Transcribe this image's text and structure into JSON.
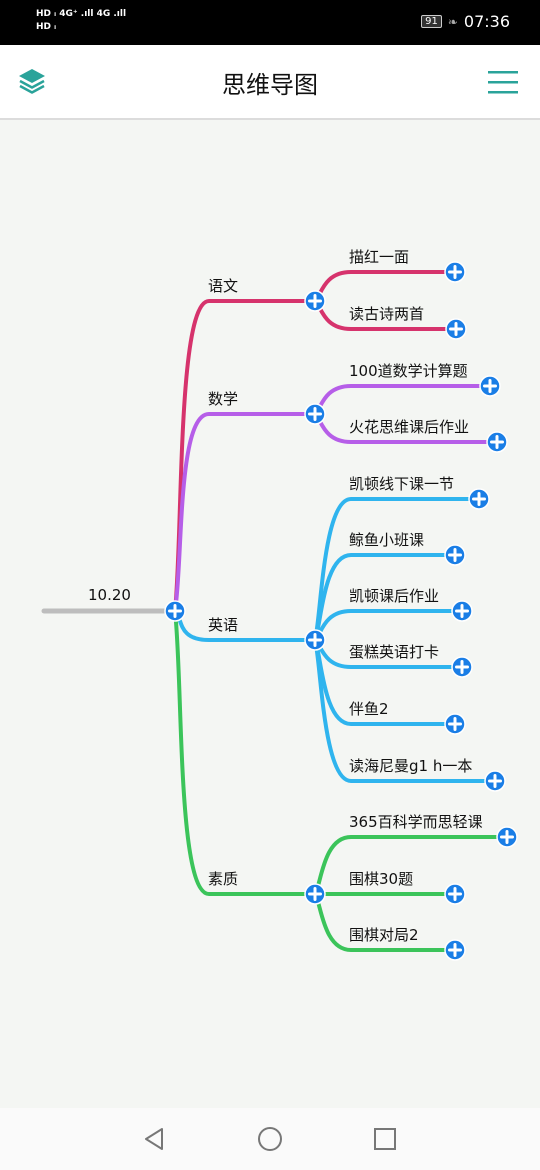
{
  "status_bar": {
    "left_top": "HD ᵢ 4G⁺ .ıll 4G .ıll",
    "left_bottom": "HD ᵢ",
    "battery": "91",
    "time": "07:36"
  },
  "header": {
    "title": "思维导图",
    "icons": {
      "left": "layers-icon",
      "right": "menu-icon"
    }
  },
  "mindmap": {
    "root": {
      "label": "10.20"
    },
    "branches": [
      {
        "label": "语文",
        "color": "#d6336c",
        "children": [
          "描红一面",
          "读古诗两首"
        ]
      },
      {
        "label": "数学",
        "color": "#b65ee8",
        "children": [
          "100道数学计算题",
          "火花思维课后作业"
        ]
      },
      {
        "label": "英语",
        "color": "#2fb4ee",
        "children": [
          "凯顿线下课一节",
          "鲸鱼小班课",
          "凯顿课后作业",
          "蛋糕英语打卡",
          "伴鱼2",
          "读海尼曼g1 h一本"
        ]
      },
      {
        "label": "素质",
        "color": "#3bc45a",
        "children": [
          "365百科学而思轻课",
          "围棋30题",
          "围棋对局2"
        ]
      }
    ],
    "add_button_color": "#1a7ee6",
    "root_line_color": "#bdbdbd"
  },
  "nav": {
    "back": "back-icon",
    "home": "home-icon",
    "recent": "recent-apps-icon"
  }
}
